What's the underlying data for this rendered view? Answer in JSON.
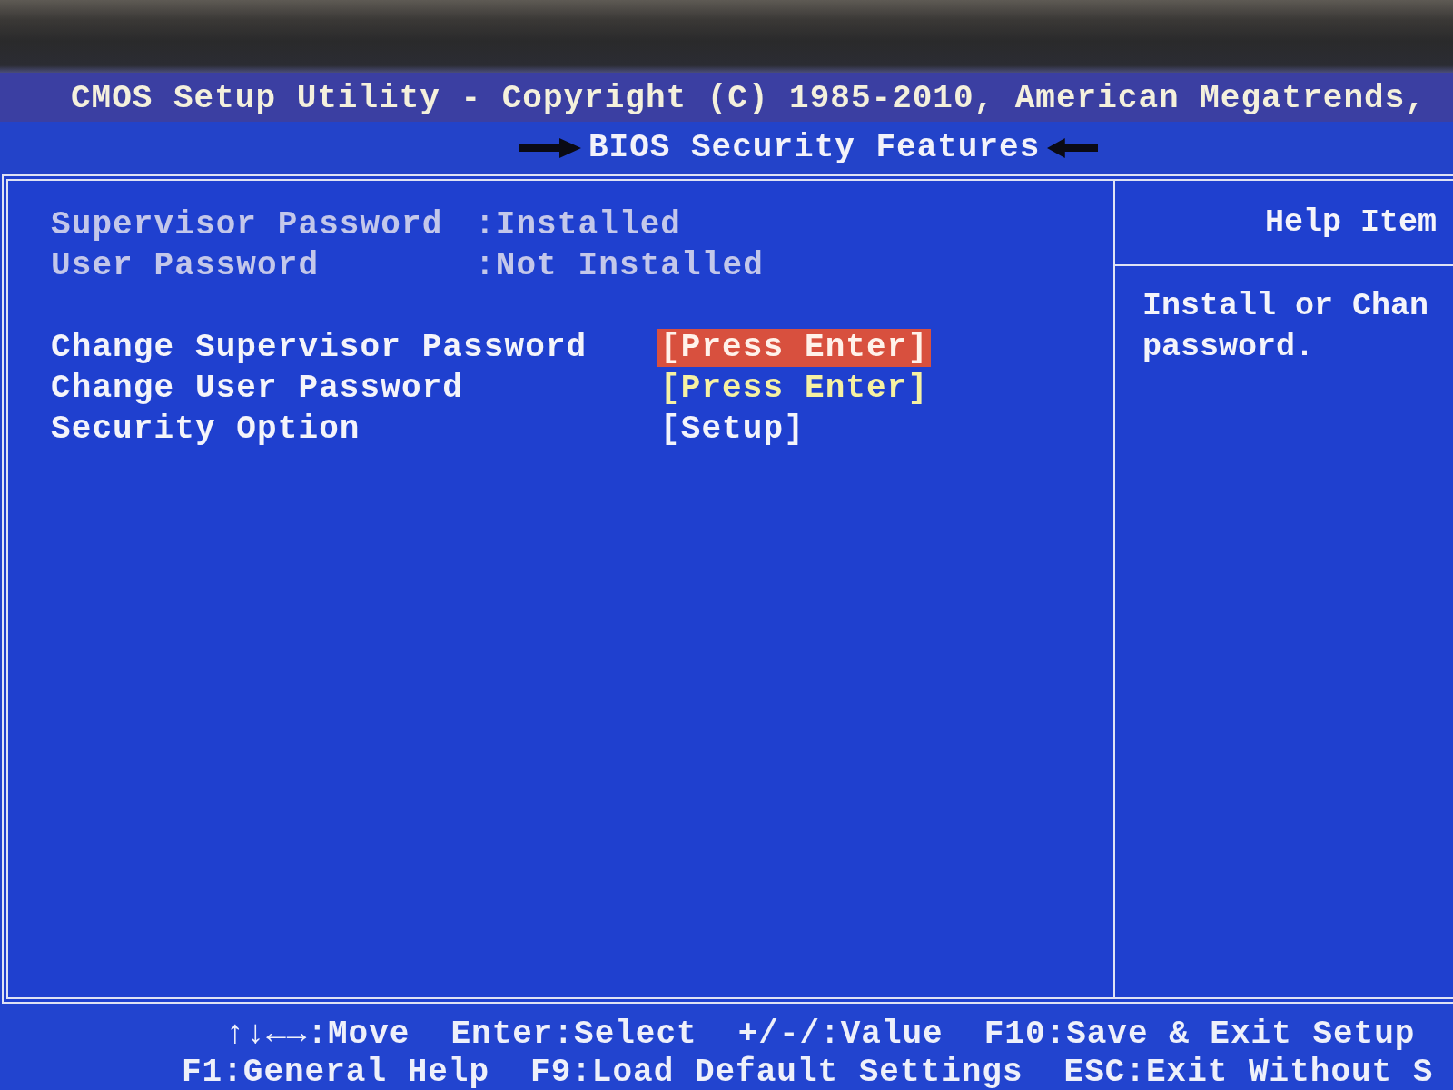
{
  "header": {
    "title": "CMOS Setup Utility - Copyright (C) 1985-2010, American Megatrends,",
    "subtitle": "BIOS Security Features"
  },
  "status_items": [
    {
      "label": "Supervisor Password",
      "value": ":Installed"
    },
    {
      "label": "User Password",
      "value": ":Not Installed"
    }
  ],
  "options": [
    {
      "label": "Change Supervisor Password",
      "value": "[Press Enter]",
      "selected": true
    },
    {
      "label": "Change User Password",
      "value": "[Press Enter]",
      "selected": false,
      "color": "#f6f1a2"
    },
    {
      "label": "Security Option",
      "value": "[Setup]",
      "selected": false,
      "color": "#f4f4fa"
    }
  ],
  "help_panel": {
    "title": "Help Item",
    "lines": [
      "Install or Chan",
      "password."
    ]
  },
  "footer": {
    "lines": [
      [
        "↑↓←→:Move",
        "Enter:Select",
        "+/-/:Value",
        "F10:Save & Exit Setup"
      ],
      [
        "F1:General Help",
        "F9:Load Default Settings",
        "ESC:Exit Without S"
      ]
    ]
  }
}
